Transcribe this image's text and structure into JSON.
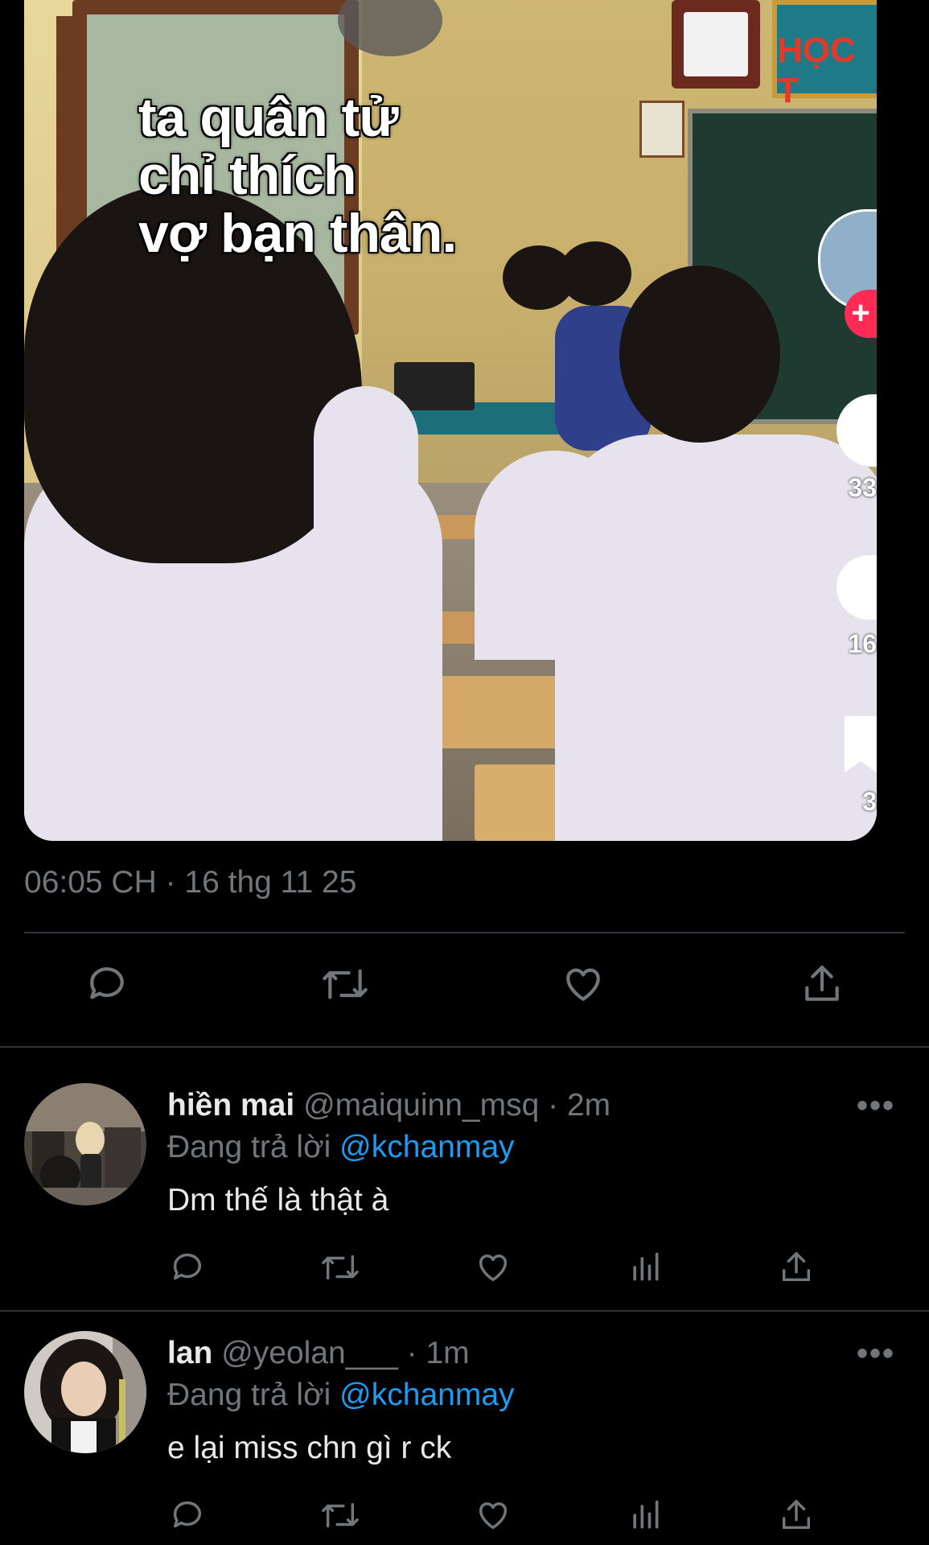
{
  "video": {
    "overlay_lines": [
      "ta quân tử",
      "chỉ thích",
      "vợ bạn thân."
    ],
    "sign_text": "HỌC T",
    "side_counts": [
      "33",
      "16",
      "3"
    ]
  },
  "tweet": {
    "timestamp": "06:05 CH · 16 thg 11 25",
    "actions": [
      "reply-icon",
      "retweet-icon",
      "like-icon",
      "share-icon"
    ]
  },
  "replies": [
    {
      "name": "hiền mai",
      "handle": "@maiquinn_msq",
      "time": "· 2m",
      "replying_label": "Đang trả lời",
      "replying_to": "@kchanmay",
      "text": "Dm thế là thật à",
      "more": "•••"
    },
    {
      "name": "lan",
      "handle": "@yeolan___",
      "time": "· 1m",
      "replying_label": "Đang trả lời",
      "replying_to": "@kchanmay",
      "text": "e lại miss chn gì r ck",
      "more": "•••"
    }
  ],
  "colors": {
    "background": "#000000",
    "text": "#e7e9ea",
    "secondary": "#71767b",
    "link": "#1d9bf0",
    "divider": "#2f3336"
  }
}
